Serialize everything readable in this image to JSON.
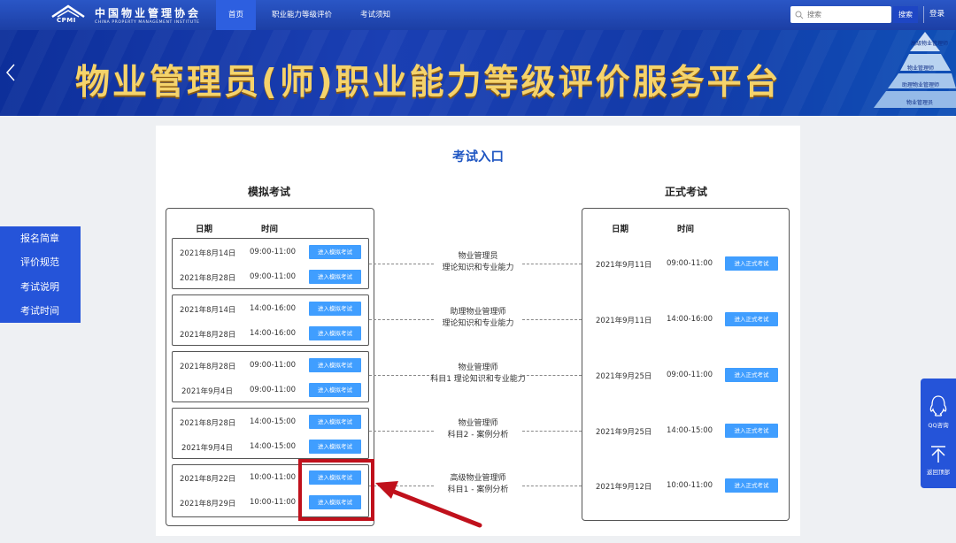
{
  "header": {
    "logo_mark_text": "CPMI",
    "logo_cn": "中国物业管理协会",
    "logo_en": "CHINA PROPERTY MANAGEMENT INSTITUTE",
    "nav": [
      "首页",
      "职业能力等级评价",
      "考试须知"
    ],
    "active_nav": "首页",
    "search_placeholder": "搜索",
    "search_button": "搜索",
    "login": "登录"
  },
  "banner": {
    "title": "物业管理员(师)职业能力等级评价服务平台",
    "pyramid": [
      "高级物业管理师",
      "物业管理师",
      "助理物业管理师",
      "物业管理员"
    ]
  },
  "side_menu": [
    "报名简章",
    "评价规范",
    "考试说明",
    "考试时间"
  ],
  "float_actions": {
    "qq": "QQ咨询",
    "top": "返回顶部"
  },
  "exam": {
    "title": "考试入口",
    "mock_title": "模拟考试",
    "formal_title": "正式考试",
    "col_date": "日期",
    "col_time": "时间",
    "mock_btn": "进入模拟考试",
    "formal_btn": "进入正式考试",
    "rows": [
      {
        "subject": [
          "物业管理员",
          "理论知识和专业能力"
        ],
        "mock": [
          [
            "2021年8月14日",
            "09:00-11:00"
          ],
          [
            "2021年8月28日",
            "09:00-11:00"
          ]
        ],
        "formal": [
          "2021年9月11日",
          "09:00-11:00"
        ]
      },
      {
        "subject": [
          "助理物业管理师",
          "理论知识和专业能力"
        ],
        "mock": [
          [
            "2021年8月14日",
            "14:00-16:00"
          ],
          [
            "2021年8月28日",
            "14:00-16:00"
          ]
        ],
        "formal": [
          "2021年9月11日",
          "14:00-16:00"
        ]
      },
      {
        "subject": [
          "物业管理师",
          "科目1 理论知识和专业能力"
        ],
        "mock": [
          [
            "2021年8月28日",
            "09:00-11:00"
          ],
          [
            "2021年9月4日",
            "09:00-11:00"
          ]
        ],
        "formal": [
          "2021年9月25日",
          "09:00-11:00"
        ]
      },
      {
        "subject": [
          "物业管理师",
          "科目2 - 案例分析"
        ],
        "mock": [
          [
            "2021年8月28日",
            "14:00-15:00"
          ],
          [
            "2021年9月4日",
            "14:00-15:00"
          ]
        ],
        "formal": [
          "2021年9月25日",
          "14:00-15:00"
        ]
      },
      {
        "subject": [
          "高级物业管理师",
          "科目1 - 案例分析"
        ],
        "mock": [
          [
            "2021年8月22日",
            "10:00-11:00"
          ],
          [
            "2021年8月29日",
            "10:00-11:00"
          ]
        ],
        "formal": [
          "2021年9月12日",
          "10:00-11:00"
        ]
      }
    ]
  },
  "colors": {
    "primary": "#2554d9",
    "button": "#409eff",
    "title": "#1f56c2",
    "highlight": "#c0111c",
    "banner_text": "#f5d36b"
  }
}
